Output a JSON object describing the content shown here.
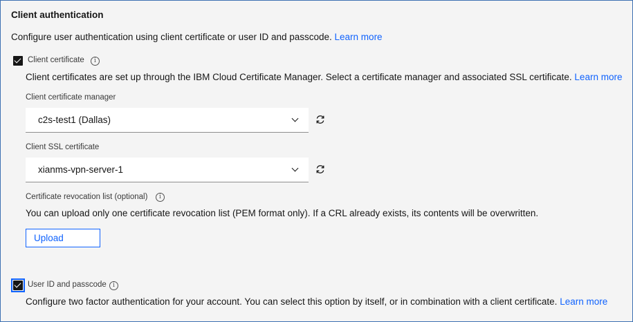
{
  "section": {
    "title": "Client authentication",
    "description": "Configure user authentication using client certificate or user ID and passcode.",
    "learn_more": "Learn more"
  },
  "client_certificate": {
    "checkbox_label": "Client certificate",
    "checked": true,
    "description": "Client certificates are set up through the IBM Cloud Certificate Manager. Select a certificate manager and associated SSL certificate.",
    "learn_more": "Learn more",
    "manager_label": "Client certificate manager",
    "manager_value": "c2s-test1 (Dallas)",
    "ssl_label": "Client SSL certificate",
    "ssl_value": "xianms-vpn-server-1",
    "crl_label": "Certificate revocation list (optional)",
    "crl_description": "You can upload only one certificate revocation list (PEM format only). If a CRL already exists, its contents will be overwritten.",
    "upload_label": "Upload"
  },
  "user_id": {
    "checkbox_label": "User ID and passcode",
    "checked": true,
    "description": "Configure two factor authentication for your account. You can select this option by itself, or in combination with a client certificate.",
    "learn_more": "Learn more"
  },
  "icons": {
    "info": "info-icon",
    "refresh": "refresh-icon",
    "chevron": "chevron-down-icon",
    "check": "checkmark-icon"
  },
  "colors": {
    "link": "#0f62fe",
    "background": "#f4f4f4",
    "checkbox": "#161616"
  }
}
